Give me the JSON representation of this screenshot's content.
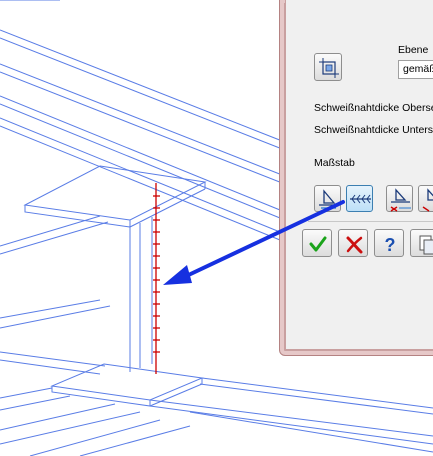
{
  "dialog": {
    "plane_label": "Ebene",
    "plane_value": "gemäß",
    "weld_top_label": "Schweißnahtdicke Obersei",
    "weld_bottom_label": "Schweißnahtdicke Unters",
    "scale_label": "Maßstab"
  },
  "icons": {
    "plane_pick": "plane-select-icon",
    "weld_a": "weld-symbol-triangle-icon",
    "weld_b": "weld-line-arrows-icon",
    "weld_c": "weld-symbol-cross-icon",
    "weld_d": "weld-symbol-partial-icon",
    "ok": "checkmark-icon",
    "cancel": "cancel-icon",
    "help": "question-icon",
    "copy": "copy-document-icon"
  },
  "colors": {
    "wireframe": "#5a7de6",
    "weld_line": "#cc0000",
    "pointer_arrow": "#1630e0",
    "dialog_frame": "#b48282"
  }
}
